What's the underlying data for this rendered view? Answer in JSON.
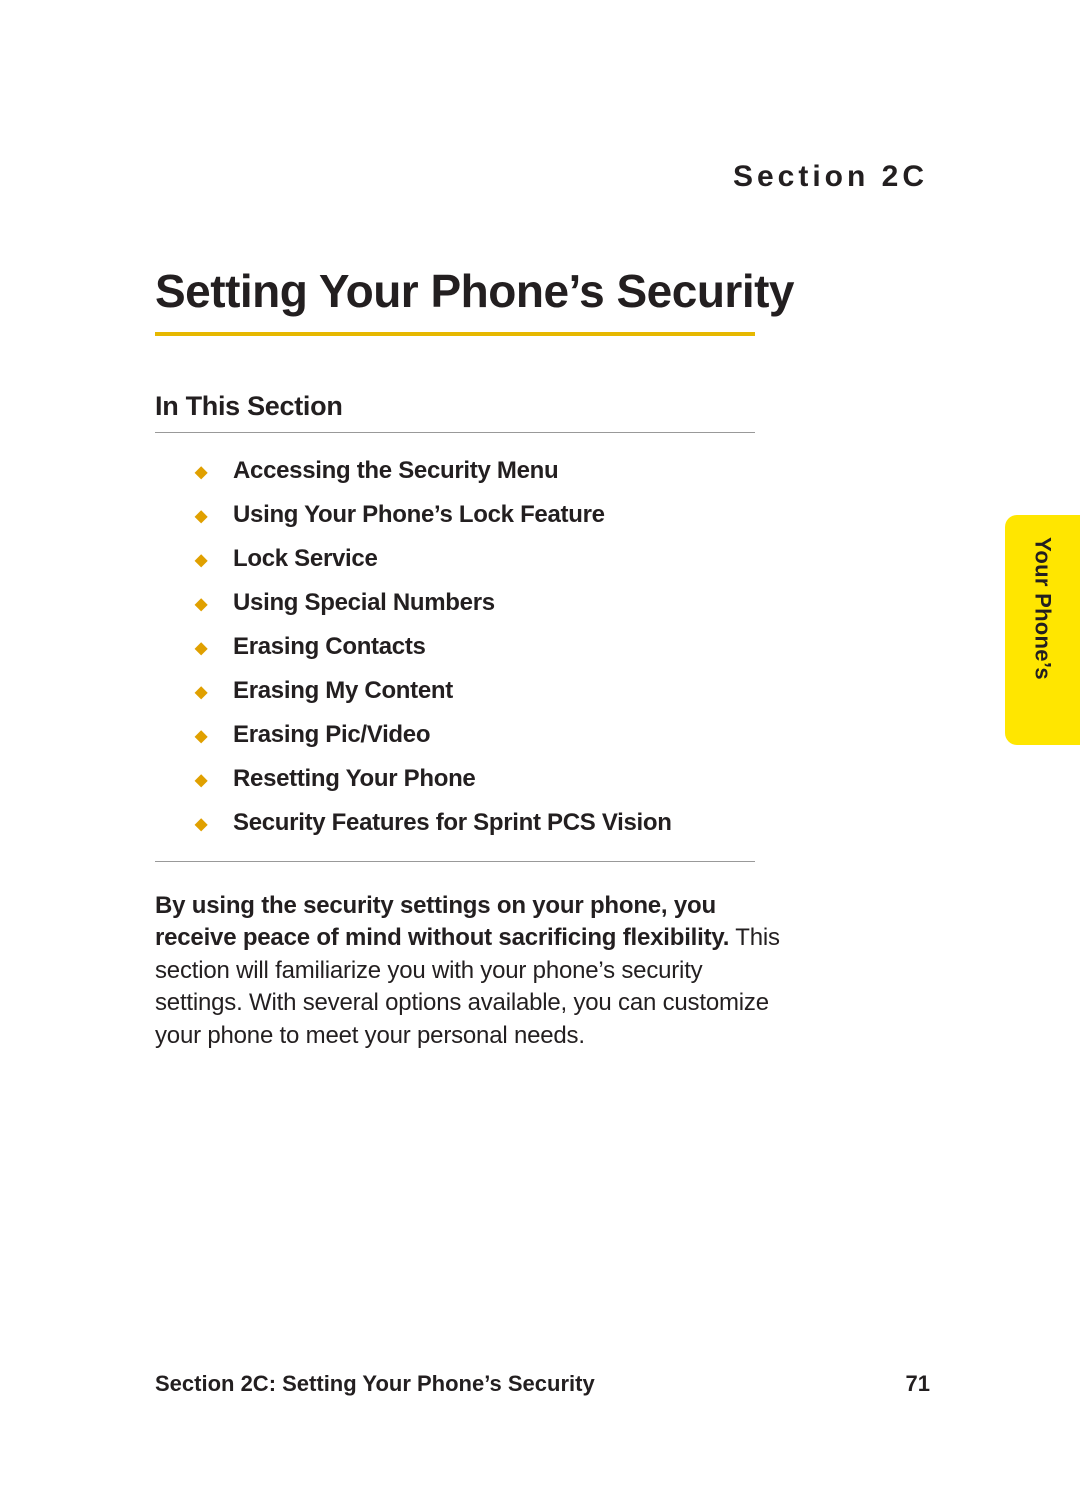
{
  "header": {
    "section_label": "Section 2C"
  },
  "title": "Setting Your Phone’s Security",
  "subhead": "In This Section",
  "toc": [
    "Accessing the Security Menu",
    "Using Your Phone’s Lock Feature",
    "Lock Service",
    "Using Special Numbers",
    "Erasing Contacts",
    "Erasing My Content",
    "Erasing Pic/Video",
    "Resetting Your Phone",
    "Security Features for Sprint PCS Vision"
  ],
  "intro": {
    "bold": "By using the security settings on your phone, you receive peace of mind without sacrificing flexibility.",
    "rest": " This section will familiarize you with your phone’s security settings. With several options available, you can customize your phone to meet your personal needs."
  },
  "side_tab": "Your Phone’s",
  "footer": {
    "text": "Section 2C: Setting Your Phone’s Security",
    "page": "71"
  }
}
